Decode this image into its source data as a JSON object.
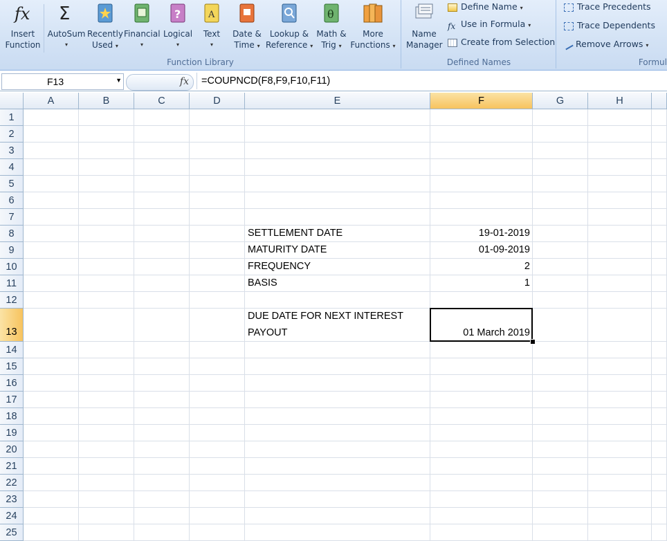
{
  "ribbon": {
    "function_library": {
      "label": "Function Library",
      "buttons": [
        {
          "line1": "Insert",
          "line2": "Function",
          "icon": "fx-icon"
        },
        {
          "line1": "AutoSum",
          "line2": "",
          "icon": "sigma-icon",
          "dropdown": true
        },
        {
          "line1": "Recently",
          "line2": "Used",
          "icon": "star-book-icon",
          "dropdown": true
        },
        {
          "line1": "Financial",
          "line2": "",
          "icon": "financial-book-icon",
          "dropdown": true
        },
        {
          "line1": "Logical",
          "line2": "",
          "icon": "question-book-icon",
          "dropdown": true
        },
        {
          "line1": "Text",
          "line2": "",
          "icon": "text-book-icon",
          "dropdown": true
        },
        {
          "line1": "Date &",
          "line2": "Time",
          "icon": "date-book-icon",
          "dropdown": true
        },
        {
          "line1": "Lookup &",
          "line2": "Reference",
          "icon": "lookup-book-icon",
          "dropdown": true
        },
        {
          "line1": "Math &",
          "line2": "Trig",
          "icon": "theta-book-icon",
          "dropdown": true
        },
        {
          "line1": "More",
          "line2": "Functions",
          "icon": "more-books-icon",
          "dropdown": true
        }
      ]
    },
    "defined_names": {
      "label": "Defined Names",
      "name_manager": {
        "line1": "Name",
        "line2": "Manager"
      },
      "define_name": "Define Name",
      "use_in_formula": "Use in Formula",
      "create_from_selection": "Create from Selection"
    },
    "formula_auditing": {
      "label": "Formul",
      "trace_precedents": "Trace Precedents",
      "trace_dependents": "Trace Dependents",
      "remove_arrows": "Remove Arrows"
    },
    "dropdown_glyph": "▾"
  },
  "formula_bar": {
    "name_box": "F13",
    "fx_symbol": "fx",
    "formula": "=COUPNCD(F8,F9,F10,F11)"
  },
  "sheet": {
    "columns": [
      "A",
      "B",
      "C",
      "D",
      "E",
      "F",
      "G",
      "H"
    ],
    "rows": [
      "1",
      "2",
      "3",
      "4",
      "5",
      "6",
      "7",
      "8",
      "9",
      "10",
      "11",
      "12",
      "13",
      "14",
      "15",
      "16",
      "17",
      "18",
      "19",
      "20",
      "21",
      "22",
      "23",
      "24",
      "25"
    ],
    "selected_column": "F",
    "selected_row": "13",
    "cells": {
      "E8": "SETTLEMENT DATE",
      "F8": "19-01-2019",
      "E9": "MATURITY DATE",
      "F9": "01-09-2019",
      "E10": "FREQUENCY",
      "F10": "2",
      "E11": "BASIS",
      "F11": "1",
      "E13_line1": "DUE DATE FOR NEXT INTEREST",
      "E13_line2": "PAYOUT",
      "F13": "01 March 2019"
    }
  },
  "colors": {
    "ribbon_bg": "#d4e3f5",
    "selected_header": "#f7c35e",
    "gridline": "#d9dfe8"
  }
}
